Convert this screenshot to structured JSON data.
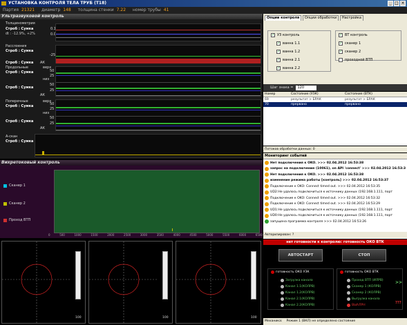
{
  "window": {
    "title": "УСТАНОВКА КОНТРОЛЯ ТЕЛА ТРУБ (Т18)",
    "controls": [
      "_",
      "□",
      "×"
    ]
  },
  "info": {
    "batch_label": "Партия",
    "batch": "21321",
    "diameter_label": "диаметр",
    "diameter": "148",
    "wall_label": "толщина стенки",
    "wall": "7.22",
    "pipe_label": "номер трубы",
    "pipe": "41"
  },
  "ultrasonic": {
    "header": "Ультразвуковой контроль",
    "channels": [
      {
        "title": "Толщинометрия",
        "strobe": "Строб : Сумка",
        "extra": "dt : -12.9%, +2%",
        "marks": [
          "0.1",
          "0.0"
        ]
      },
      {
        "title": "Расслоения",
        "strobe": "Строб : Сумка",
        "marks": [
          "-25"
        ],
        "ak": "АК"
      },
      {
        "title": "Продольные",
        "side1": "верх",
        "side2": "низ",
        "strobe": "Строб : Сумка",
        "strobe2": "Строб : Сумка",
        "marks": [
          "50",
          "25",
          "50",
          "25"
        ],
        "ak": "АК",
        "ak2": "АК"
      },
      {
        "title": "Поперечные",
        "side1": "верх",
        "side2": "низ",
        "strobe": "Строб : Сумка",
        "strobe2": "Строб : Сумка",
        "marks": [
          "50",
          "25",
          "50",
          "25"
        ],
        "ak": "АК",
        "ak2": "АК"
      },
      {
        "title": "А-скан",
        "strobe": "Строб : Сумка"
      }
    ]
  },
  "eddy": {
    "header": "Вихретоковый контроль",
    "legend": [
      {
        "label": "Сканер 1",
        "color": "#00c0e0"
      },
      {
        "label": "Сканер 2",
        "color": "#c0c000"
      },
      {
        "label": "Проход ВТП",
        "color": "#d03030"
      }
    ],
    "x_ticks": [
      "0",
      "500",
      "1000",
      "1500",
      "2000",
      "2500",
      "3000",
      "3500",
      "4000",
      "4500",
      "5000",
      "5500",
      "6000",
      "6500"
    ]
  },
  "settings": {
    "tabs": [
      "Опции контроля",
      "Опции обработки",
      "Настройка"
    ],
    "uz_group": "УЗ контроль",
    "uz_items": [
      "ванна 1.1",
      "ванна 1.2",
      "ванна 2.1",
      "ванна 2.2"
    ],
    "vt_group": "ВТ контроль",
    "vt_items": [
      "сканер 1",
      "сканер 2",
      "проходной ВТП"
    ],
    "step_label": "Шаг знака =",
    "step_value": "120"
  },
  "results": {
    "headers": [
      "Номер",
      "Состояние (УЗК)",
      "Состояние (ВТК)"
    ],
    "rows": [
      {
        "num": "69",
        "uz": "результат > БРАК",
        "vt": "результат > БРАК"
      },
      {
        "num": "70",
        "uz": "прервано",
        "vt": "прервано"
      }
    ],
    "footer": "Потоков обработки данных:   0"
  },
  "events": {
    "header": "Мониторинг событий",
    "items": [
      {
        "icon": "#f0a000",
        "text": "Нет подключения к OKO. >>> 02.04.2012 16:53:38",
        "bold": true
      },
      {
        "icon": "#f0a000",
        "text": "запрос на подключение (10061), on API 'connect' >>> 02.04.2012 16:53:38",
        "bold": true
      },
      {
        "icon": "#f0a000",
        "text": "Нет подключения к OKO. >>> 02.04.2012 16:53:38",
        "bold": true
      },
      {
        "icon": "#f0a000",
        "text": "изменение режима работы [контроль] >>> 02.04.2012 16:53:37",
        "bold": true
      },
      {
        "icon": "#f0a000",
        "text": "Подключение к OKO: Connect timed out. >>> 02.04.2012 16:53:35",
        "bold": false
      },
      {
        "icon": "#f0a000",
        "text": "UD2:Не удалось подключиться к источнику данных (192.168.1.111, порт",
        "bold": false
      },
      {
        "icon": "#f0a000",
        "text": "Подключение к OKO: Connect timed out. >>> 02.04.2012 16:53:32",
        "bold": false
      },
      {
        "icon": "#f0a000",
        "text": "Подключение к OKO: Connect timed out. >>> 02.04.2012 16:53:29",
        "bold": false
      },
      {
        "icon": "#f0a000",
        "text": "UD1:Не удалось подключиться к источнику данных (192.168.1.111, порт",
        "bold": false
      },
      {
        "icon": "#f0a000",
        "text": "UD0:Не удалось подключиться к источнику данных (192.168.1.111, порт",
        "bold": false
      },
      {
        "icon": "#30a030",
        "text": "запущена программа контроля >>> 02.04.2012 16:53:26",
        "bold": false
      }
    ],
    "footer": "Авторизирован: ?"
  },
  "control": {
    "status": "нет готовности к контролю: готовность ОКО ВТК",
    "start": "АВТОСТАРТ",
    "stop": "СТОП",
    "uz_ready": "готовность ОКО УЗК",
    "vt_ready": "готовность ОКО ВТК",
    "uz_list": [
      "Загрузка канала",
      "Канал 1.1(КОЛРВ)",
      "Канал 1.2(КОЛРВ)",
      "Канал 2.1(КОЛРВ)",
      "Канал 2.2(КОЛРВ)"
    ],
    "vt_list": [
      "Проход ВТП (ИЛРВ)",
      "Сканер 1 (КОЛРВ)",
      "Сканер 2 (КОЛРВ)",
      "Выгрузка канала"
    ],
    "vt_alarm": "ВЫАЛРН",
    "arrows": ">>",
    "arrows2": "???",
    "footer_label": "Механика:",
    "footer_mode": "Режим 1 (ВКЛ) не определено состояние"
  },
  "scopes": {
    "level_values": [
      "100",
      "100",
      "100"
    ]
  }
}
